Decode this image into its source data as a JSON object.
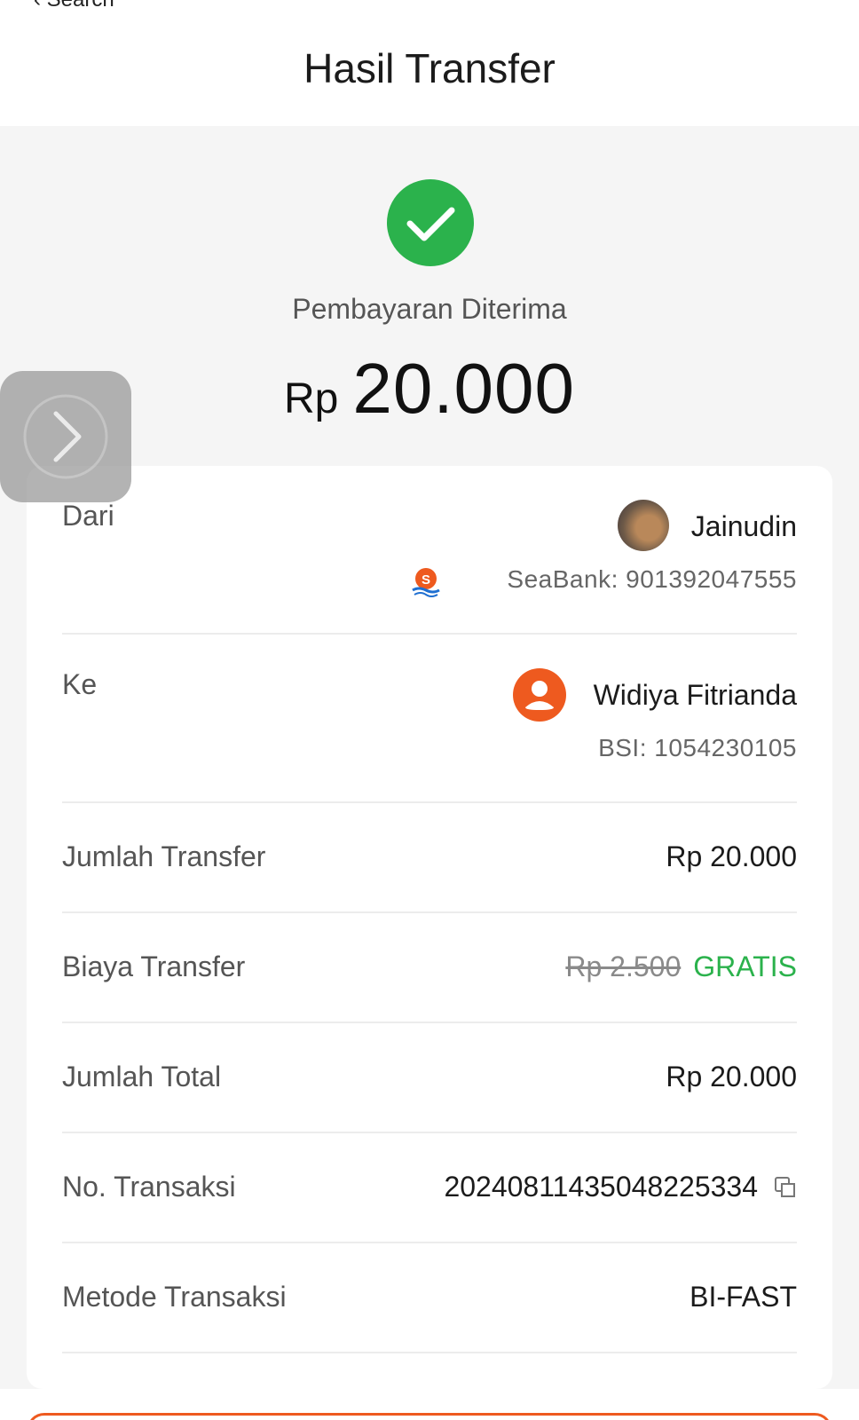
{
  "header": {
    "back_label": "‹ Search",
    "title": "Hasil Transfer"
  },
  "status": {
    "icon": "check-circle-icon",
    "text": "Pembayaran Diterima",
    "currency": "Rp",
    "amount": "20.000"
  },
  "details": {
    "from": {
      "label": "Dari",
      "name": "Jainudin",
      "account": "SeaBank: 901392047555"
    },
    "to": {
      "label": "Ke",
      "name": "Widiya Fitrianda",
      "account": "BSI: 1054230105"
    },
    "transfer_amount": {
      "label": "Jumlah Transfer",
      "value": "Rp 20.000"
    },
    "transfer_fee": {
      "label": "Biaya Transfer",
      "original": "Rp 2.500",
      "value": "GRATIS"
    },
    "total": {
      "label": "Jumlah Total",
      "value": "Rp 20.000"
    },
    "transaction_no": {
      "label": "No. Transaksi",
      "value": "20240811435048225334"
    },
    "method": {
      "label": "Metode Transaksi",
      "value": "BI-FAST"
    }
  },
  "colors": {
    "success": "#2bb24c",
    "accent": "#ee5a1f"
  }
}
